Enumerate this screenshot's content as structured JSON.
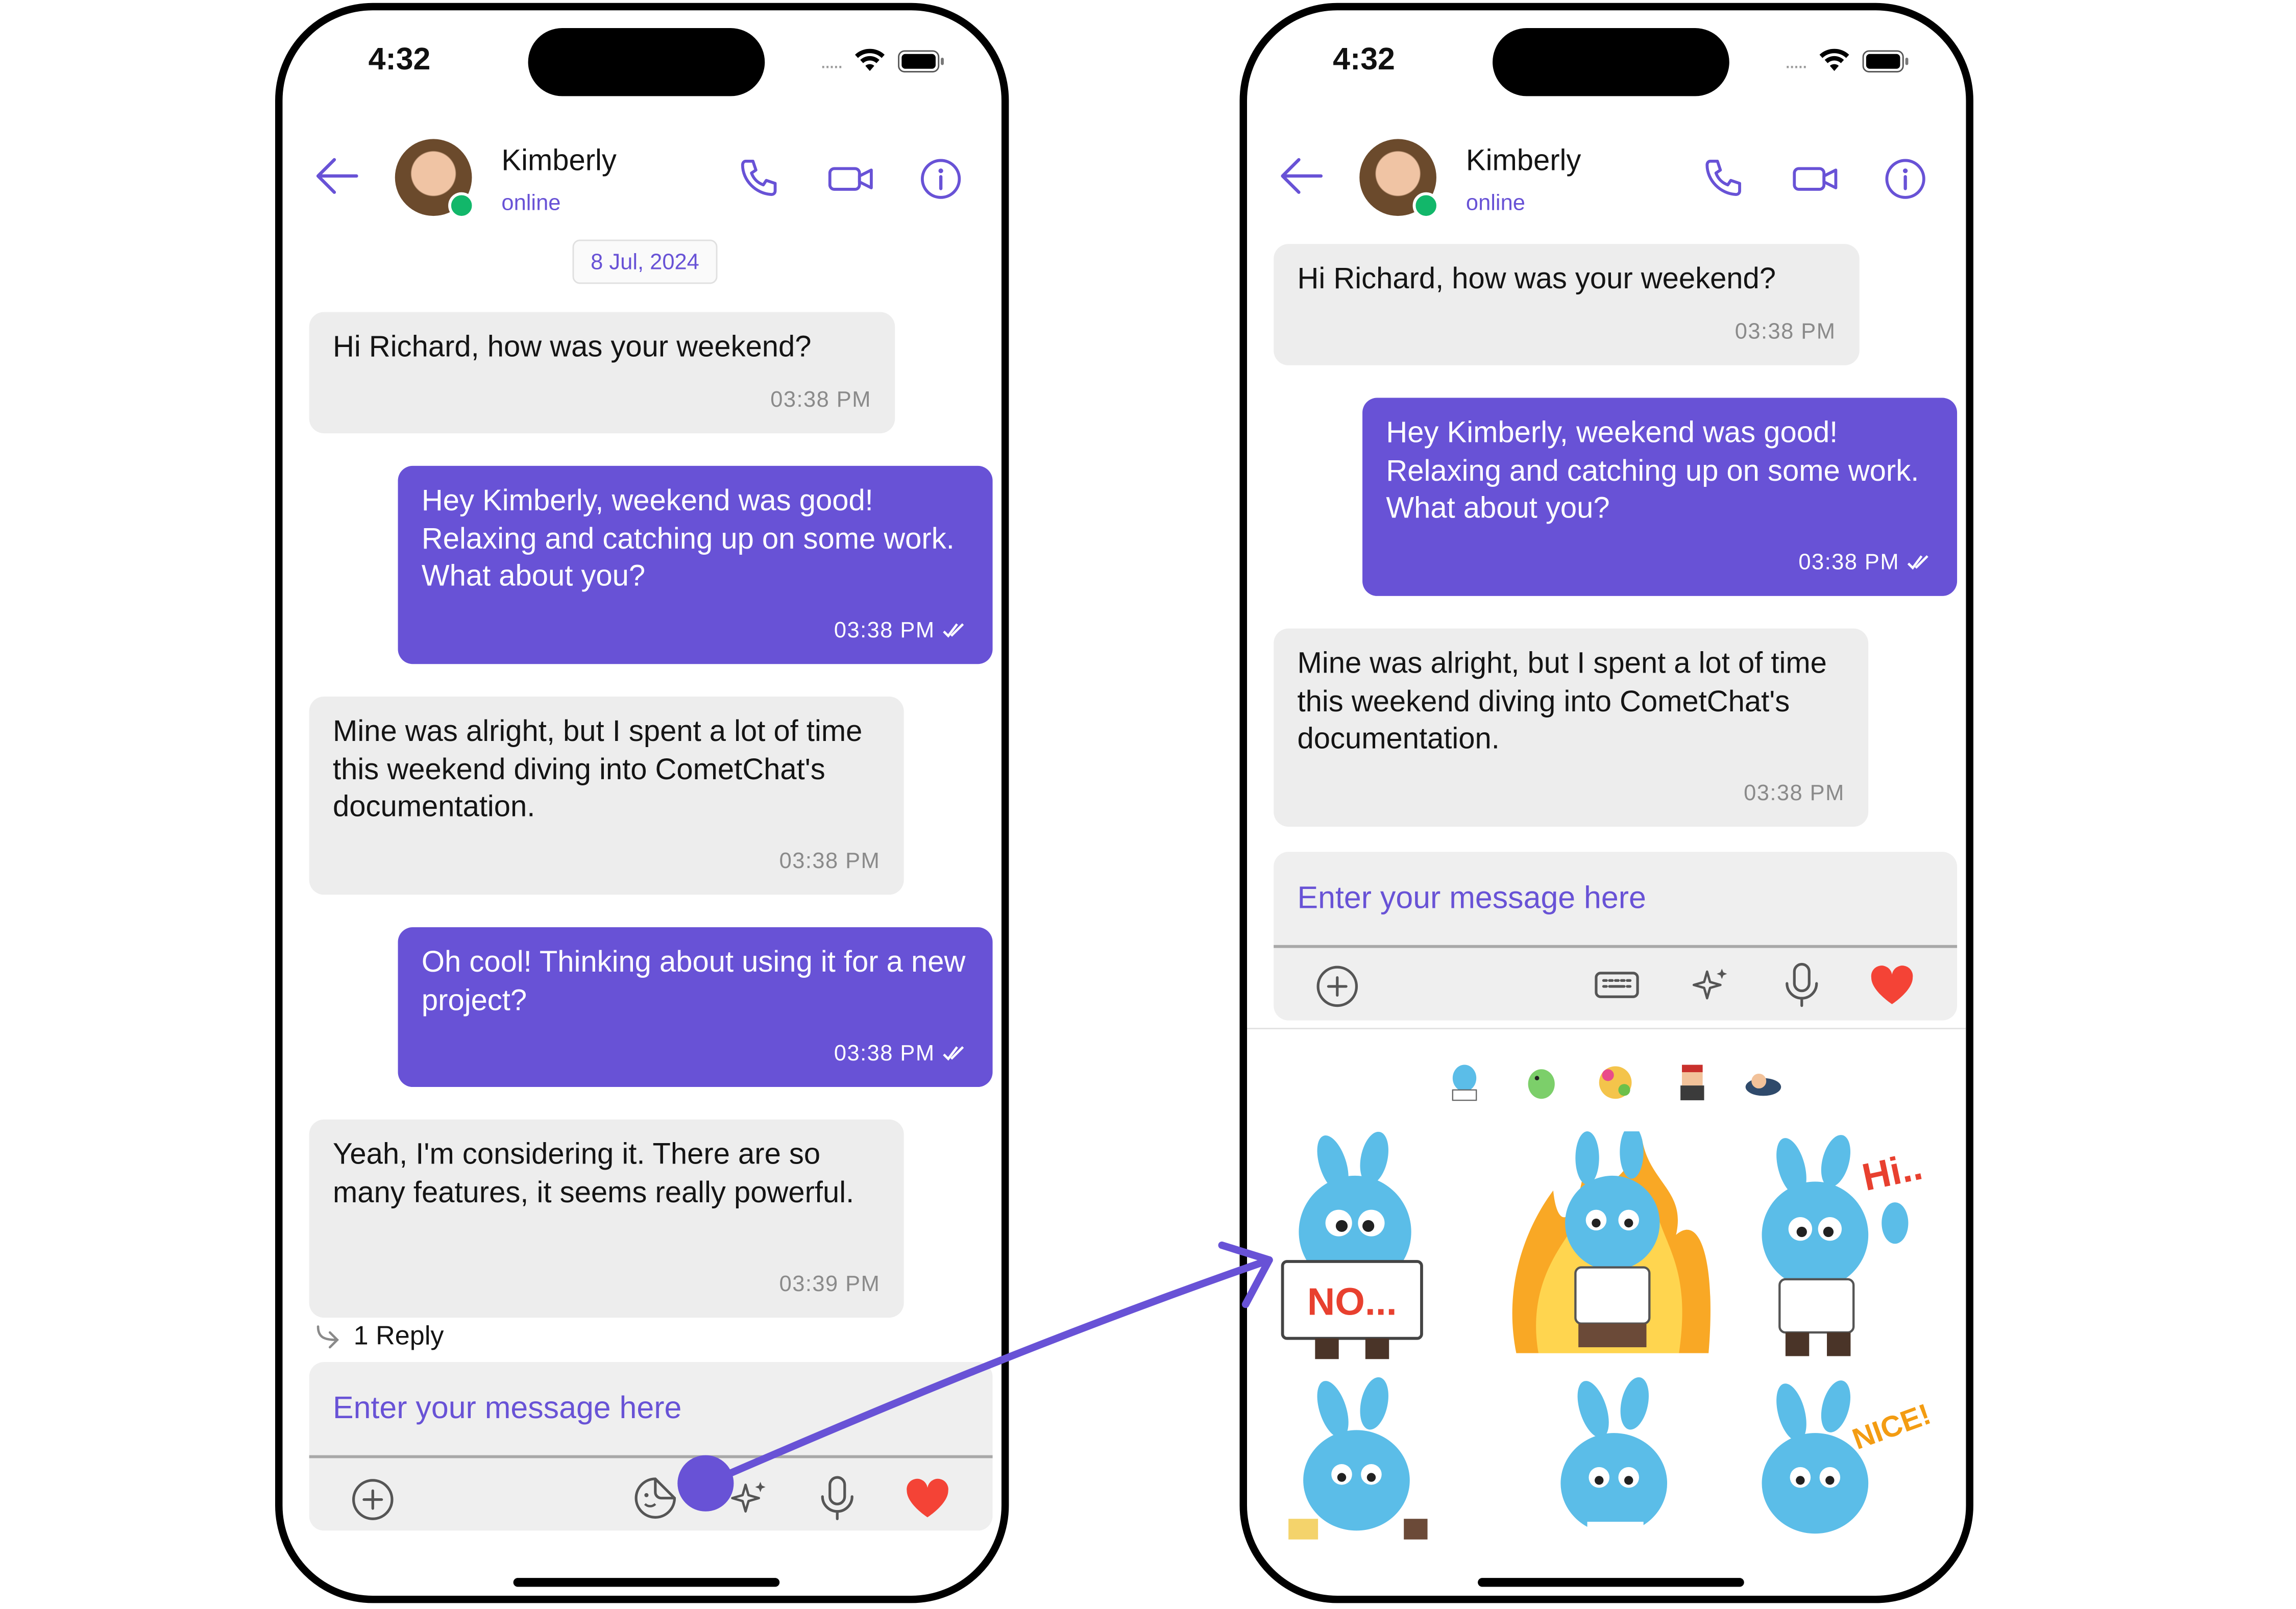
{
  "status_bar": {
    "time": "4:32",
    "dots": "....."
  },
  "header": {
    "name": "Kimberly",
    "status": "online"
  },
  "date_separator": "8 Jul, 2024",
  "left_messages": [
    {
      "direction": "incoming",
      "text": "Hi Richard, how was your weekend?",
      "time": "03:38 PM"
    },
    {
      "direction": "outgoing",
      "text": "Hey Kimberly, weekend was good! Relaxing and catching up on some work.  What about you?",
      "time": "03:38 PM"
    },
    {
      "direction": "incoming",
      "text": "Mine was alright, but I spent a lot of time this weekend diving into CometChat's documentation.",
      "time": "03:38 PM"
    },
    {
      "direction": "outgoing",
      "text": "Oh cool! Thinking about using it for a new project?",
      "time": "03:38 PM"
    },
    {
      "direction": "incoming",
      "text": "Yeah, I'm considering it.  There are so many features, it seems really powerful.",
      "time": "03:39 PM"
    }
  ],
  "reply_indicator": "1 Reply",
  "composer": {
    "placeholder": "Enter your message here"
  },
  "right_messages": [
    {
      "direction": "incoming",
      "text": "Hi Richard, how was your weekend?",
      "time": "03:38 PM"
    },
    {
      "direction": "outgoing",
      "text": "Hey Kimberly, weekend was good! Relaxing and catching up on some work.  What about you?",
      "time": "03:38 PM"
    },
    {
      "direction": "incoming",
      "text": "Mine was alright, but I spent a lot of time this weekend diving into CometChat's documentation.",
      "time": "03:38 PM"
    }
  ],
  "stickers": {
    "tabs": [
      "no-sticker-tab",
      "dino-sticker-tab",
      "party-sticker-tab",
      "character-sticker-tab",
      "sleep-sticker-tab"
    ],
    "labels": [
      "NO...",
      "Hi..",
      "NICE!"
    ]
  },
  "colors": {
    "accent": "#6852d6",
    "incoming_bubble": "#ededed",
    "online": "#12b76a",
    "heart": "#f44336"
  }
}
